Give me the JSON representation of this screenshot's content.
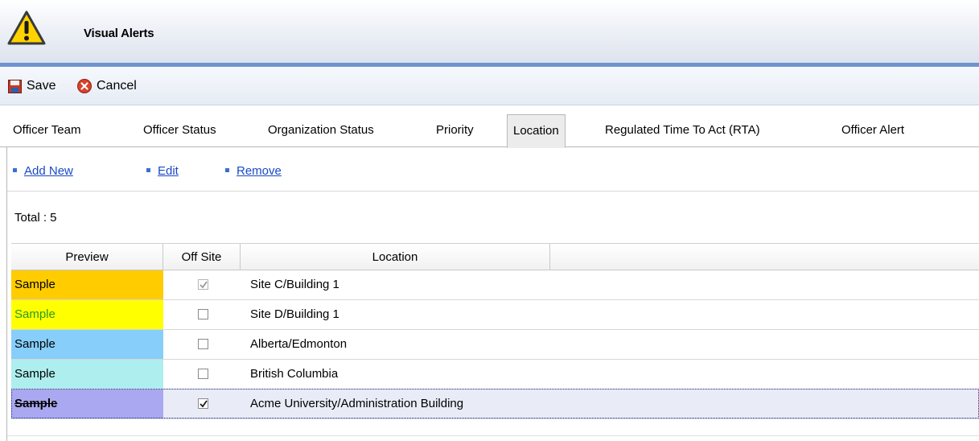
{
  "window": {
    "title": "Visual Alerts",
    "icon": "warning-triangle-icon"
  },
  "toolbar": {
    "save_label": "Save",
    "save_icon": "floppy-disk-icon",
    "cancel_label": "Cancel",
    "cancel_icon": "cancel-circle-icon"
  },
  "tabs": [
    {
      "label": "Officer Team",
      "active": false
    },
    {
      "label": "Officer Status",
      "active": false
    },
    {
      "label": "Organization Status",
      "active": false
    },
    {
      "label": "Priority",
      "active": false
    },
    {
      "label": "Location",
      "active": true
    },
    {
      "label": "Regulated Time To Act (RTA)",
      "active": false
    },
    {
      "label": "Officer Alert",
      "active": false
    }
  ],
  "actions": {
    "add_new": "Add New",
    "edit": "Edit",
    "remove": "Remove"
  },
  "summary": {
    "total": "Total : 5"
  },
  "grid": {
    "columns": {
      "preview": "Preview",
      "off_site": "Off Site",
      "location": "Location"
    },
    "rows": [
      {
        "preview_text": "Sample",
        "preview_bg": "#ffcc00",
        "preview_fg": "#000000",
        "off_site": true,
        "off_site_disabled": true,
        "location": "Site C/Building 1"
      },
      {
        "preview_text": "Sample",
        "preview_bg": "#ffff00",
        "preview_fg": "#2a9b1a",
        "off_site": false,
        "location": "Site D/Building 1"
      },
      {
        "preview_text": "Sample",
        "preview_bg": "#87cefa",
        "preview_fg": "#000000",
        "off_site": false,
        "location": "Alberta/Edmonton"
      },
      {
        "preview_text": "Sample",
        "preview_bg": "#aeeeee",
        "preview_fg": "#000000",
        "off_site": false,
        "location": "British Columbia"
      },
      {
        "preview_text": "Sample",
        "preview_bg": "#aaa8f0",
        "preview_fg": "#000000",
        "off_site": true,
        "strikethrough": true,
        "selected": true,
        "location": "Acme University/Administration Building"
      }
    ]
  },
  "colors": {
    "accent_rule": "#6e93cf",
    "link": "#1a49c6"
  }
}
